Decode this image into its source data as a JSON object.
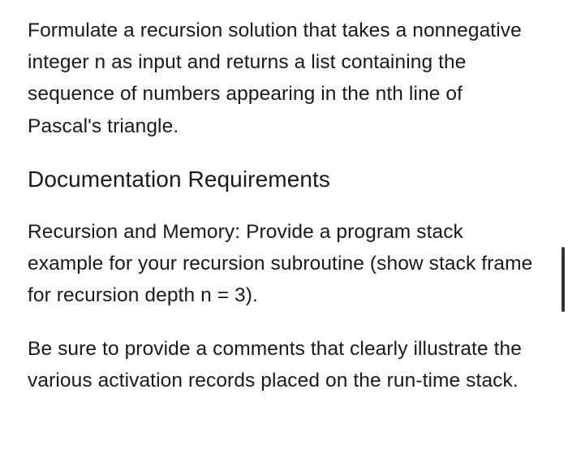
{
  "paragraphs": {
    "p1": "Formulate a recursion solution that takes a nonnegative integer n as input and returns a list containing the sequence of numbers appearing in the nth line of Pascal's triangle.",
    "p2": "Recursion and Memory:  Provide a program stack example for your recursion subroutine (show stack frame for recursion depth n = 3).",
    "p3": "Be sure to provide a comments that clearly illustrate the various activation records placed on the run-time stack."
  },
  "heading": "Documentation Requirements"
}
